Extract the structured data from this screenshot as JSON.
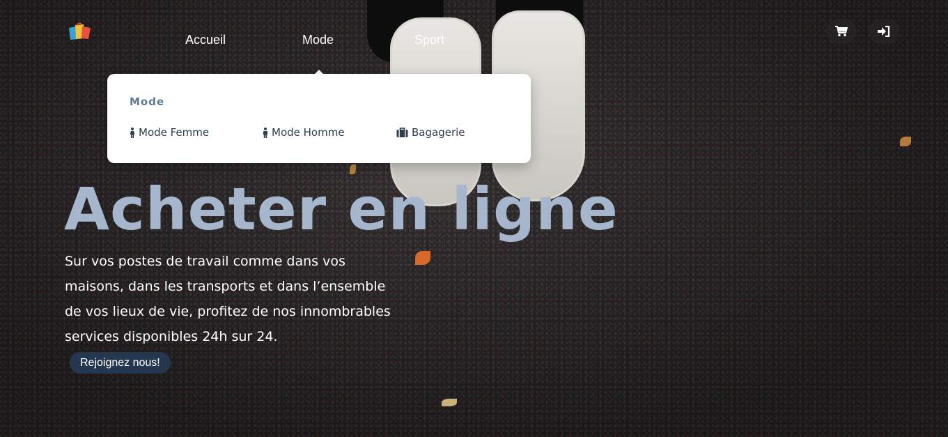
{
  "nav": {
    "items": [
      {
        "label": "Accueil"
      },
      {
        "label": "Mode"
      },
      {
        "label": "Sport"
      }
    ],
    "icons": [
      "cart-icon",
      "login-icon"
    ]
  },
  "dropdown": {
    "title": "Mode",
    "items": [
      {
        "label": "Mode Femme",
        "icon": "female-icon"
      },
      {
        "label": "Mode Homme",
        "icon": "male-icon"
      },
      {
        "label": "Bagagerie",
        "icon": "luggage-icon"
      }
    ]
  },
  "hero": {
    "title": "Acheter en ligne",
    "description": "Sur vos postes de travail comme dans vos maisons, dans les transports et dans l’ensemble de vos lieux de vie, profitez de nos innombrables services disponibles 24h sur 24.",
    "cta_label": "Rejoignez nous!"
  },
  "colors": {
    "title": "#a6b6cc",
    "cta_bg": "#26384f",
    "dropdown_title": "#5f7a90",
    "dropdown_text": "#2f3b4a"
  }
}
